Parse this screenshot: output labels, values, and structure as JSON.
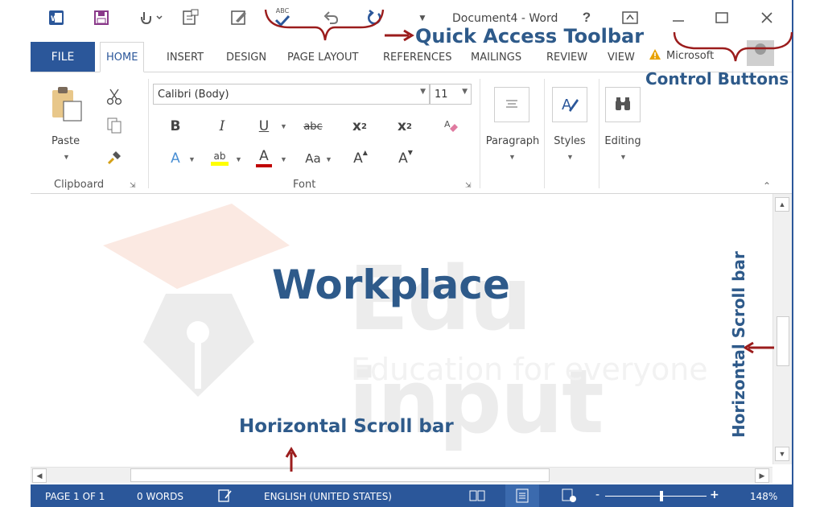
{
  "title_bar": {
    "document_title": "Document4 - Word",
    "help_label": "?",
    "quick_access": [
      {
        "icon": "word-logo-icon"
      },
      {
        "icon": "save-icon"
      },
      {
        "icon": "touch-mode-icon"
      },
      {
        "icon": "new-document-icon"
      },
      {
        "icon": "edit-document-icon"
      },
      {
        "icon": "spelling-check-icon",
        "label": "ABC"
      },
      {
        "icon": "undo-icon"
      },
      {
        "icon": "redo-icon"
      },
      {
        "icon": "customize-toolbar-icon"
      }
    ]
  },
  "tabs": [
    "FILE",
    "HOME",
    "INSERT",
    "DESIGN",
    "PAGE LAYOUT",
    "REFERENCES",
    "MAILINGS",
    "REVIEW",
    "VIEW"
  ],
  "active_tab": "HOME",
  "account": {
    "name": "Microsoft"
  },
  "ribbon": {
    "clipboard": {
      "paste_label": "Paste",
      "group_label": "Clipboard"
    },
    "font": {
      "font_name": "Calibri (Body)",
      "font_size": "11",
      "group_label": "Font",
      "bold": "B",
      "italic": "I",
      "underline": "U",
      "strikethrough": "abc",
      "subscript": "x",
      "subscript_mark": "2",
      "superscript": "x",
      "superscript_mark": "2",
      "text_effects": "A",
      "highlight": "ab",
      "font_color": "A",
      "change_case": "Aa",
      "grow_font": "A",
      "shrink_font": "A"
    },
    "paragraph_label": "Paragraph",
    "styles_label": "Styles",
    "editing_label": "Editing"
  },
  "document": {
    "heading": "Workplace",
    "watermark_title": "Edu input",
    "watermark_tagline": "Education for everyone"
  },
  "status_bar": {
    "page": "PAGE 1 OF 1",
    "words": "0 WORDS",
    "language": "ENGLISH (UNITED STATES)",
    "zoom_minus": "-",
    "zoom_plus": "+",
    "zoom": "148%"
  },
  "annotations": {
    "quick_access": "Quick Access Toolbar",
    "control_buttons": "Control Buttons",
    "horizontal_scroll": "Horizontal Scroll bar",
    "vertical_scroll": "Horizontal Scroll bar"
  },
  "colors": {
    "word_blue": "#2b579a",
    "annotation_blue": "#2e5a8a",
    "annotation_red": "#9b1c1c"
  }
}
